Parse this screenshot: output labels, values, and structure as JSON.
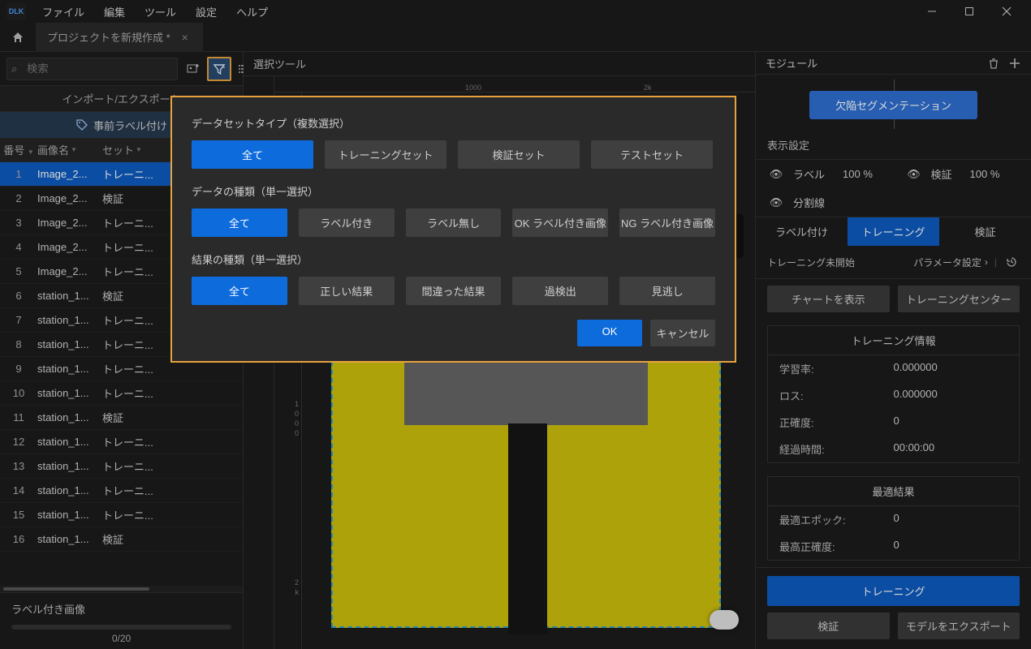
{
  "app": {
    "logo_text": "DLK"
  },
  "menu": {
    "file": "ファイル",
    "edit": "編集",
    "tool": "ツール",
    "settings": "設定",
    "help": "ヘルプ"
  },
  "tab": {
    "title": "プロジェクトを新規作成 *"
  },
  "sidebar": {
    "search_placeholder": "検索",
    "import_export": "インポート/エクスポート",
    "prelabel": "事前ラベル付け",
    "columns": {
      "idx": "番号",
      "name": "画像名",
      "set": "セット"
    },
    "rows": [
      {
        "idx": "1",
        "name": "Image_2...",
        "set": "トレーニ..."
      },
      {
        "idx": "2",
        "name": "Image_2...",
        "set": "検証"
      },
      {
        "idx": "3",
        "name": "Image_2...",
        "set": "トレーニ..."
      },
      {
        "idx": "4",
        "name": "Image_2...",
        "set": "トレーニ..."
      },
      {
        "idx": "5",
        "name": "Image_2...",
        "set": "トレーニ..."
      },
      {
        "idx": "6",
        "name": "station_1...",
        "set": "検証"
      },
      {
        "idx": "7",
        "name": "station_1...",
        "set": "トレーニ..."
      },
      {
        "idx": "8",
        "name": "station_1...",
        "set": "トレーニ..."
      },
      {
        "idx": "9",
        "name": "station_1...",
        "set": "トレーニ..."
      },
      {
        "idx": "10",
        "name": "station_1...",
        "set": "トレーニ..."
      },
      {
        "idx": "11",
        "name": "station_1...",
        "set": "検証"
      },
      {
        "idx": "12",
        "name": "station_1...",
        "set": "トレーニ..."
      },
      {
        "idx": "13",
        "name": "station_1...",
        "set": "トレーニ..."
      },
      {
        "idx": "14",
        "name": "station_1...",
        "set": "トレーニ..."
      },
      {
        "idx": "15",
        "name": "station_1...",
        "set": "トレーニ..."
      },
      {
        "idx": "16",
        "name": "station_1...",
        "set": "検証"
      }
    ],
    "labeled_title": "ラベル付き画像",
    "labeled_count": "0/20"
  },
  "center": {
    "header": "選択ツール",
    "ruler_marks_h": [
      "1000",
      "2k"
    ],
    "ruler_marks_v": [
      "1",
      "0",
      "0",
      "0",
      "2",
      "k"
    ]
  },
  "rpanel": {
    "title": "モジュール",
    "module_name": "欠陥セグメンテーション",
    "display_settings": "表示設定",
    "label_row_label": "ラベル",
    "label_row_val": "100 %",
    "verify_row_label": "検証",
    "verify_row_val": "100 %",
    "split_label": "分割線",
    "tabs": {
      "labeling": "ラベル付け",
      "training": "トレーニング",
      "verify": "検証"
    },
    "status": "トレーニング未開始",
    "param_link": "パラメータ設定",
    "show_chart": "チャートを表示",
    "training_center": "トレーニングセンター",
    "training_info_title": "トレーニング情報",
    "rows": [
      {
        "k": "学習率:",
        "v": "0.000000"
      },
      {
        "k": "ロス:",
        "v": "0.000000"
      },
      {
        "k": "正確度:",
        "v": "0"
      },
      {
        "k": "経過時間:",
        "v": "00:00:00"
      }
    ],
    "best_title": "最適結果",
    "best_rows": [
      {
        "k": "最適エポック:",
        "v": "0"
      },
      {
        "k": "最高正確度:",
        "v": "0"
      }
    ],
    "train_btn": "トレーニング",
    "verify_btn": "検証",
    "export_btn": "モデルをエクスポート"
  },
  "modal": {
    "sec1_title": "データセットタイプ（複数選択）",
    "sec1_opts": [
      "全て",
      "トレーニングセット",
      "検証セット",
      "テストセット"
    ],
    "sec2_title": "データの種類（単一選択）",
    "sec2_opts": [
      "全て",
      "ラベル付き",
      "ラベル無し",
      "OK ラベル付き画像",
      "NG ラベル付き画像"
    ],
    "sec3_title": "結果の種類（単一選択）",
    "sec3_opts": [
      "全て",
      "正しい結果",
      "間違った結果",
      "過検出",
      "見逃し"
    ],
    "ok": "OK",
    "cancel": "キャンセル"
  }
}
